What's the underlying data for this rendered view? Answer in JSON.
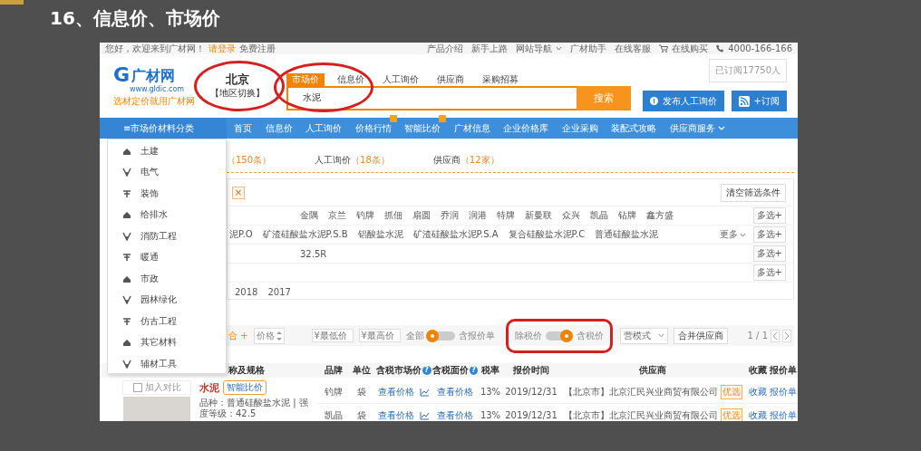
{
  "slide_title": "16、信息价、市场价",
  "site": {
    "top_bar": {
      "greeting": "您好，欢迎来到广材网！",
      "login": "请登录",
      "register": "免费注册",
      "links": [
        {
          "label": "产品介绍",
          "kind": "text"
        },
        {
          "label": "新手上路",
          "kind": "text"
        },
        {
          "label": "网站导航",
          "kind": "dropdown"
        },
        {
          "label": "广材助手",
          "kind": "text"
        },
        {
          "label": "在线客服",
          "kind": "text"
        },
        {
          "label": "在线购买",
          "kind": "cart"
        },
        {
          "label": "4000-166-166",
          "kind": "phone"
        }
      ]
    },
    "logo": {
      "mark": "G",
      "name": "广材网",
      "url": "www.gldic.com",
      "slogan": "选材定价就用广材网"
    },
    "city": {
      "name": "北京",
      "switch": "【地区切换】"
    },
    "search": {
      "tabs": [
        {
          "label": "市场价",
          "selected": true
        },
        {
          "label": "信息价",
          "selected": false
        },
        {
          "label": "人工询价",
          "selected": false
        },
        {
          "label": "供应商",
          "selected": false
        },
        {
          "label": "采购招募",
          "selected": false
        }
      ],
      "value": "水泥",
      "button": "搜索"
    },
    "subscribers": "已订阅17750人",
    "actions": [
      {
        "label": "发布人工询价",
        "kind": "publish"
      },
      {
        "label": "+订阅",
        "kind": "rss"
      }
    ],
    "nav": {
      "category_button": "≡市场价材料分类",
      "items": [
        {
          "label": "首页",
          "badge": false,
          "kind": "link"
        },
        {
          "label": "信息价",
          "badge": false,
          "kind": "link"
        },
        {
          "label": "人工询价",
          "badge": false,
          "kind": "link"
        },
        {
          "label": "价格行情",
          "badge": true,
          "kind": "link"
        },
        {
          "label": "智能比价",
          "badge": true,
          "kind": "link"
        },
        {
          "label": "广材信息",
          "badge": false,
          "kind": "link"
        },
        {
          "label": "企业价格库",
          "badge": false,
          "kind": "link"
        },
        {
          "label": "企业采购",
          "badge": false,
          "kind": "link"
        },
        {
          "label": "装配式攻略",
          "badge": false,
          "kind": "link"
        },
        {
          "label": "供应商服务",
          "badge": false,
          "kind": "dropdown"
        }
      ]
    },
    "category_menu": [
      "土建",
      "电气",
      "装饰",
      "给排水",
      "消防工程",
      "暖通",
      "市政",
      "园林绿化",
      "仿古工程",
      "其它材料",
      "辅材工具"
    ],
    "result_tabs": [
      {
        "count": "（150条）"
      },
      {
        "label": "人工询价",
        "count": "（18条）"
      },
      {
        "label": "供应商",
        "count": "（12家）"
      }
    ],
    "filters": {
      "chip_close": "×",
      "clear_button": "清空筛选条件",
      "rows": [
        {
          "options": [
            "金隅",
            "京兰",
            "钓牌",
            "抓佃",
            "扇圆",
            "乔润",
            "润港",
            "特牌",
            "新曼联",
            "众兴",
            "凯晶",
            "钻牌",
            "鑫方盛"
          ],
          "multi_select": "多选+"
        },
        {
          "options": [
            "泥P.O",
            "矿渣硅酸盐水泥P.S.B",
            "铝酸盐水泥",
            "矿渣硅酸盐水泥P.S.A",
            "复合硅酸盐水泥P.C",
            "普通硅酸盐水泥"
          ],
          "more": "更多",
          "multi_select": "多选+"
        },
        {
          "options": [
            "32.5R"
          ],
          "multi_select": "多选+"
        },
        {
          "options": [],
          "multi_select": "多选+"
        },
        {
          "options": [
            "2018",
            "2017"
          ]
        }
      ]
    },
    "toolbar": {
      "sort": "合 +",
      "price_sort": "价格",
      "min_price": {
        "placeholder": "¥最低价"
      },
      "max_price": {
        "placeholder": "¥最高价"
      },
      "toggles": [
        {
          "left": "全部",
          "right": "含报价单",
          "on": false
        },
        {
          "left": "除税价",
          "right": "含税价",
          "on": true
        }
      ],
      "mode_select": "营模式",
      "merge_button": "合并供应商",
      "pager": "1 / 1"
    },
    "table": {
      "columns": [
        {
          "label": "称及规格"
        },
        {
          "label": "品牌"
        },
        {
          "label": "单位"
        },
        {
          "label": "含税市场价",
          "help_icon": "?"
        },
        {
          "label": "含税面价",
          "help_icon": "?"
        },
        {
          "label": "税率"
        },
        {
          "label": "报价时间"
        },
        {
          "label": "供应商"
        },
        {
          "label": "收藏"
        },
        {
          "label": "报价单"
        }
      ]
    },
    "product": {
      "compare": "加入对比",
      "compare_checked": false,
      "name": "水泥",
      "compare_badge": "智能比价",
      "spec": "品种：普通硅酸盐水泥 | 强度等级：42.5",
      "rows": [
        {
          "brand": "钓牌",
          "unit": "袋",
          "market_price": "查看价格",
          "list_price": "查看价格",
          "tax": "13%",
          "date": "2019/12/31",
          "supplier": "【北京市】北京汇民兴业商贸有限公司",
          "tag": "优选",
          "favorite": "收藏",
          "quote": "报价单"
        },
        {
          "brand": "凯晶",
          "unit": "袋",
          "market_price": "查看价格",
          "list_price": "查看价格",
          "tax": "13%",
          "date": "2019/12/31",
          "supplier": "【北京市】北京汇民兴业商贸有限公司",
          "tag": "优选",
          "favorite": "收藏",
          "quote": "报价单"
        }
      ]
    },
    "annotations": [
      {
        "kind": "ellipse"
      },
      {
        "kind": "ellipse"
      },
      {
        "kind": "frame"
      }
    ]
  }
}
